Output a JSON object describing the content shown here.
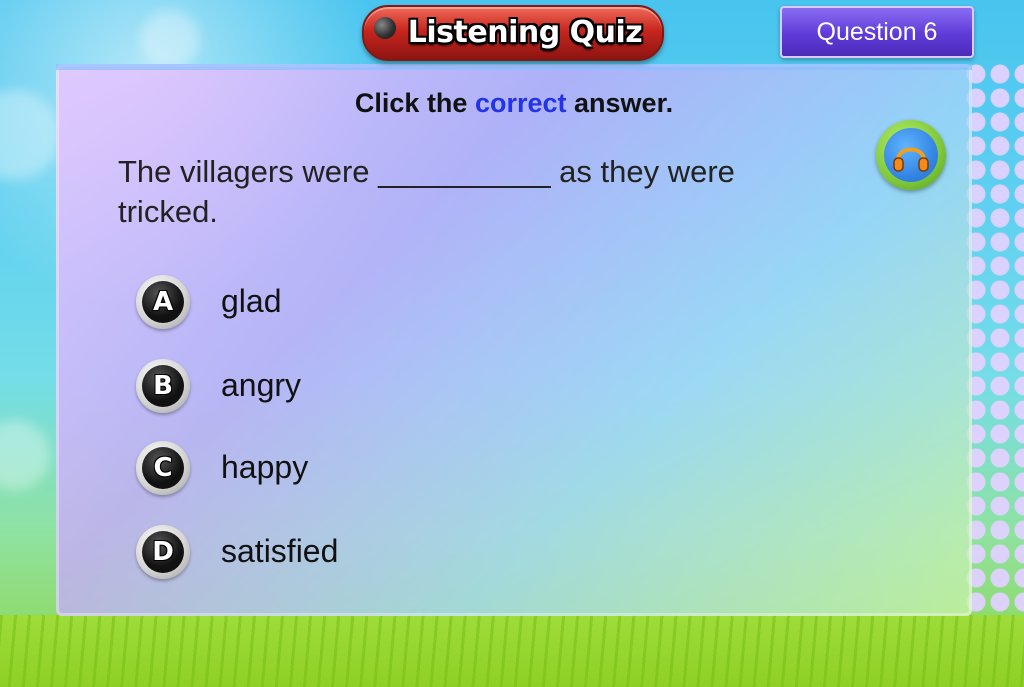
{
  "header": {
    "title": "Listening Quiz",
    "question_badge": "Question 6"
  },
  "instruction": {
    "before": "Click the",
    "highlight": "correct",
    "after": "answer."
  },
  "question": {
    "prompt": "The villagers were __________ as they were tricked."
  },
  "audio_button": {
    "icon": "headphones-icon"
  },
  "options": [
    {
      "letter": "A",
      "label": "glad"
    },
    {
      "letter": "B",
      "label": "angry"
    },
    {
      "letter": "C",
      "label": "happy"
    },
    {
      "letter": "D",
      "label": "satisfied"
    }
  ],
  "colors": {
    "title_red": "#c7261e",
    "badge_purple": "#5e3bd8",
    "highlight_blue": "#2233e8",
    "audio_green": "#7fc83a"
  }
}
